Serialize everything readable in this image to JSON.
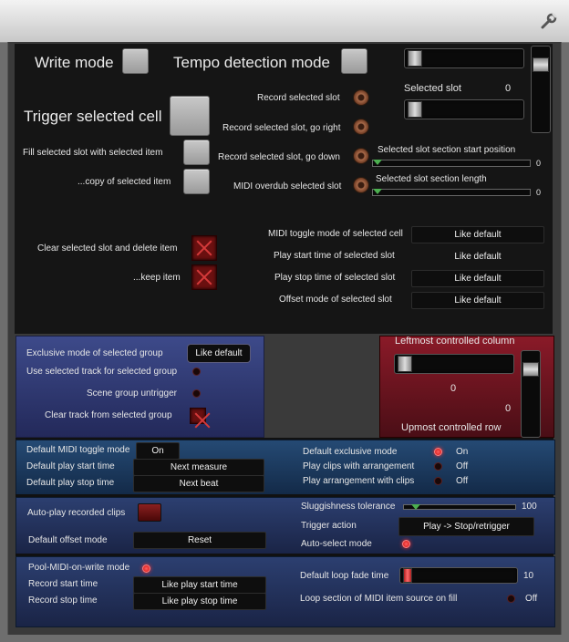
{
  "top": {
    "wrench_icon": "wrench-icon"
  },
  "main": {
    "write_mode": "Write mode",
    "tempo_detection_mode": "Tempo detection mode",
    "trigger_selected_cell": "Trigger selected cell",
    "fill_selected_slot": "Fill selected slot with selected item",
    "copy_selected_item": "...copy of selected item",
    "record_selected_slot": "Record selected slot",
    "record_go_right": "Record selected slot, go right",
    "record_go_down": "Record selected slot, go down",
    "midi_overdub": "MIDI overdub selected slot",
    "selected_slot_label": "Selected slot",
    "selected_slot_value": "0",
    "section_start_label": "Selected slot section start position",
    "section_start_value": "0",
    "section_length_label": "Selected slot section length",
    "section_length_value": "0",
    "clear_delete": "Clear selected slot and delete item",
    "keep_item": "...keep item",
    "midi_toggle_label": "MIDI toggle mode of selected cell",
    "midi_toggle_value": "Like default",
    "play_start_label": "Play start time of selected slot",
    "play_start_value": "Like default",
    "play_stop_label": "Play stop time of selected slot",
    "play_stop_value": "Like default",
    "offset_label": "Offset mode of selected slot",
    "offset_value": "Like default"
  },
  "group": {
    "exclusive_label": "Exclusive mode of selected group",
    "exclusive_value": "Like default",
    "use_track": "Use selected track for selected group",
    "scene_untrigger": "Scene group untrigger",
    "clear_track": "Clear track from selected group"
  },
  "controlled": {
    "leftmost_label": "Leftmost controlled column",
    "leftmost_value": "0",
    "upmost_value": "0",
    "upmost_label": "Upmost controlled row"
  },
  "defaults": {
    "midi_toggle_label": "Default MIDI toggle mode",
    "midi_toggle_value": "On",
    "play_start_label": "Default play start time",
    "play_start_value": "Next measure",
    "play_stop_label": "Default play stop time",
    "play_stop_value": "Next beat",
    "exclusive_label": "Default exclusive mode",
    "exclusive_value": "On",
    "clips_arrangement_label": "Play clips with arrangement",
    "clips_arrangement_value": "Off",
    "arrangement_clips_label": "Play arrangement with clips",
    "arrangement_clips_value": "Off"
  },
  "autoplay": {
    "autoplay_label": "Auto-play recorded clips",
    "offset_label": "Default offset mode",
    "offset_value": "Reset",
    "sluggishness_label": "Sluggishness tolerance",
    "sluggishness_value": "100",
    "trigger_action_label": "Trigger action",
    "trigger_action_value": "Play -> Stop/retrigger",
    "autoselect_label": "Auto-select mode"
  },
  "pool": {
    "pool_label": "Pool-MIDI-on-write mode",
    "record_start_label": "Record start time",
    "record_start_value": "Like play start time",
    "record_stop_label": "Record stop time",
    "record_stop_value": "Like play stop time",
    "loop_fade_label": "Default loop fade time",
    "loop_fade_value": "10",
    "loop_section_label": "Loop section of MIDI item source on fill",
    "loop_section_value": "Off"
  }
}
